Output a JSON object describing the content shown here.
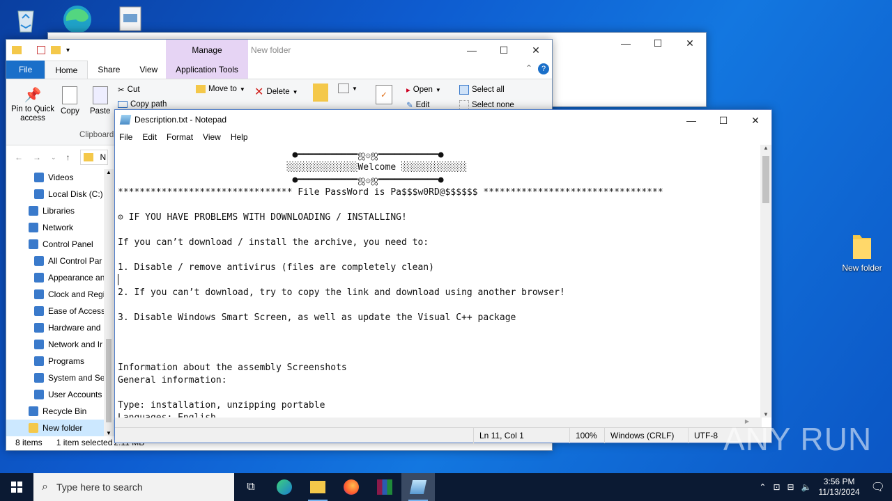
{
  "desktop": {
    "icons": [
      {
        "name": "recycle-bin",
        "label": ""
      },
      {
        "name": "edge",
        "label": ""
      },
      {
        "name": "file",
        "label": ""
      },
      {
        "name": "new-folder",
        "label": "New folder"
      }
    ]
  },
  "explorer": {
    "title": "New folder",
    "tabs": {
      "file": "File",
      "home": "Home",
      "share": "Share",
      "view": "View",
      "manage": "Manage",
      "app_tools": "Application Tools"
    },
    "ribbon": {
      "pin": "Pin to Quick access",
      "copy": "Copy",
      "paste": "Paste",
      "cut": "Cut",
      "copy_path": "Copy path",
      "move_to": "Move to",
      "delete": "Delete",
      "open": "Open",
      "edit": "Edit",
      "select_all": "Select all",
      "select_none": "Select none",
      "clipboard": "Clipboard"
    },
    "address": "N",
    "tree": [
      {
        "icon": "videos-icon",
        "label": "Videos"
      },
      {
        "icon": "disk-icon",
        "label": "Local Disk (C:)"
      },
      {
        "icon": "libraries-icon",
        "label": "Libraries"
      },
      {
        "icon": "network-icon",
        "label": "Network"
      },
      {
        "icon": "control-panel-icon",
        "label": "Control Panel"
      },
      {
        "icon": "control-panel-icon",
        "label": "All Control Par"
      },
      {
        "icon": "appearance-icon",
        "label": "Appearance an"
      },
      {
        "icon": "clock-icon",
        "label": "Clock and Regi"
      },
      {
        "icon": "ease-icon",
        "label": "Ease of Access"
      },
      {
        "icon": "hardware-icon",
        "label": "Hardware and"
      },
      {
        "icon": "network-icon",
        "label": "Network and Ir"
      },
      {
        "icon": "programs-icon",
        "label": "Programs"
      },
      {
        "icon": "system-icon",
        "label": "System and Sec"
      },
      {
        "icon": "users-icon",
        "label": "User Accounts"
      },
      {
        "icon": "recycle-icon",
        "label": "Recycle Bin"
      },
      {
        "icon": "folder-icon",
        "label": "New folder"
      }
    ],
    "status_items": "8 items",
    "status_selected": "1 item selected",
    "status_size": "2.11 MB"
  },
  "notepad": {
    "title": "Description.txt - Notepad",
    "menu": [
      "File",
      "Edit",
      "Format",
      "View",
      "Help"
    ],
    "lines": [
      "                                ●━━━━━━━━━━━ஜ۞ஜ━━━━━━━━━━━●",
      "                               ░░░░░░░░░░░░░Welcome ░░░░░░░░░░░░",
      "                                ●━━━━━━━━━━━ஜ۞ஜ━━━━━━━━━━━●",
      "******************************** File PassWord is Pa$$$w0RD@$$$$$$ *********************************",
      "",
      "⊝ IF YOU HAVE PROBLEMS WITH DOWNLOADING / INSTALLING!",
      "",
      "If you can’t download / install the archive, you need to:",
      "",
      "1. Disable / remove antivirus (files are completely clean)",
      "",
      "2. If you can’t download, try to copy the link and download using another browser!",
      "",
      "3. Disable Windows Smart Screen, as well as update the Visual C++ package",
      "",
      "",
      "",
      "Information about the assembly Screenshots",
      "General information:",
      "",
      "Type: installation, unzipping portable",
      "Languages: English"
    ],
    "status": {
      "position": "Ln 11, Col 1",
      "zoom": "100%",
      "eol": "Windows (CRLF)",
      "encoding": "UTF-8"
    }
  },
  "taskbar": {
    "search_placeholder": "Type here to search",
    "time": "3:56 PM",
    "date": "11/13/2024"
  },
  "watermark": "ANY RUN"
}
